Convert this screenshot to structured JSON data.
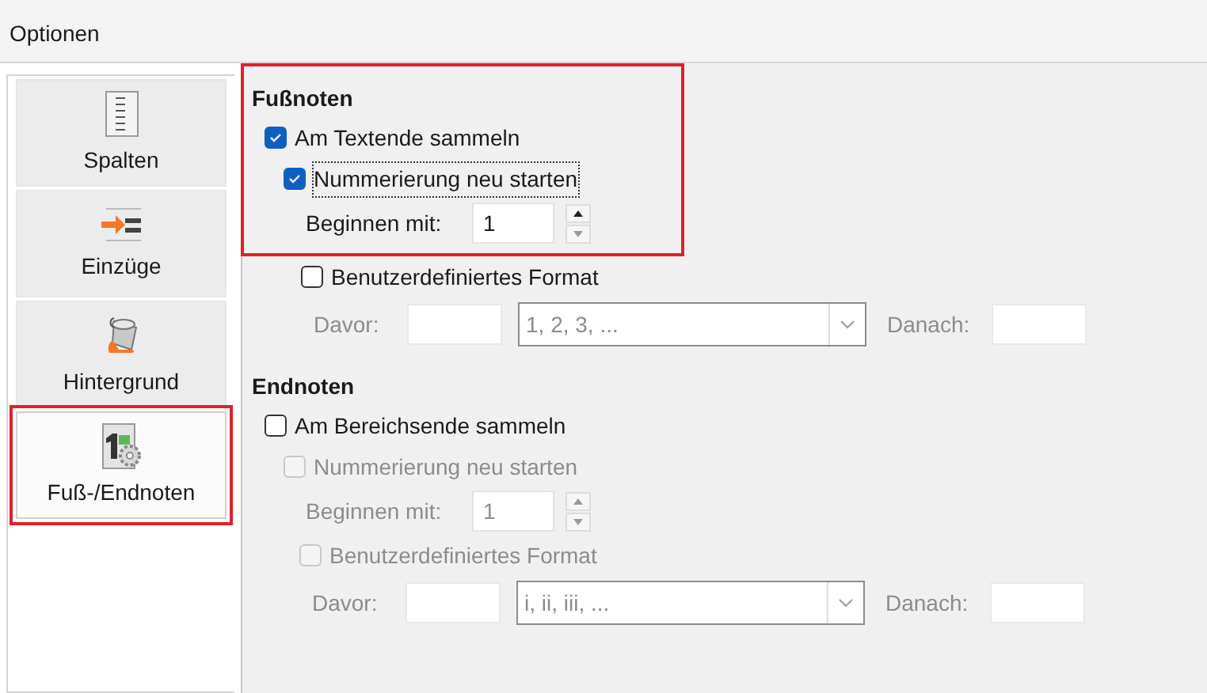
{
  "window": {
    "title": "Optionen"
  },
  "sidebar": {
    "items": [
      {
        "label": "Spalten",
        "kind": "columns",
        "selected": false,
        "highlighted": false
      },
      {
        "label": "Einzüge",
        "kind": "indent",
        "selected": false,
        "highlighted": false
      },
      {
        "label": "Hintergrund",
        "kind": "background",
        "selected": false,
        "highlighted": false
      },
      {
        "label": "Fuß-/Endnoten",
        "kind": "notes",
        "selected": true,
        "highlighted": true
      }
    ]
  },
  "sections": [
    {
      "title": "Fußnoten",
      "highlighted": true,
      "collect": {
        "label": "Am Textende sammeln",
        "checked": true,
        "disabled": false
      },
      "restart": {
        "label": "Nummerierung neu starten",
        "checked": true,
        "disabled": false,
        "focused": true
      },
      "start": {
        "label": "Beginnen mit:",
        "value": "1",
        "disabled": false
      },
      "custom_format": {
        "label": "Benutzerdefiniertes Format",
        "checked": false,
        "disabled": false
      },
      "format_row": {
        "before_label": "Davor:",
        "format": "1, 2, 3, ...",
        "after_label": "Danach:",
        "disabled": true
      }
    },
    {
      "title": "Endnoten",
      "highlighted": false,
      "collect": {
        "label": "Am Bereichsende sammeln",
        "checked": false,
        "disabled": false
      },
      "restart": {
        "label": "Nummerierung neu starten",
        "checked": false,
        "disabled": true,
        "focused": false
      },
      "start": {
        "label": "Beginnen mit:",
        "value": "1",
        "disabled": true
      },
      "custom_format": {
        "label": "Benutzerdefiniertes Format",
        "checked": false,
        "disabled": true
      },
      "format_row": {
        "before_label": "Davor:",
        "format": "i, ii, iii, ...",
        "after_label": "Danach:",
        "disabled": true
      }
    }
  ]
}
